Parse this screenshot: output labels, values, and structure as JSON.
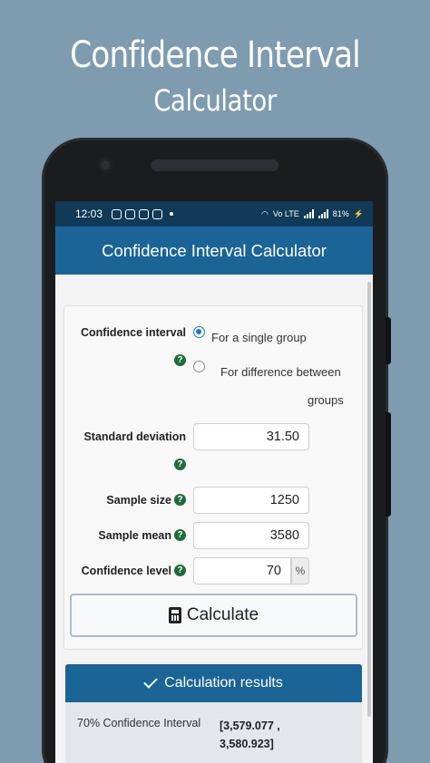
{
  "promo": {
    "title_line1": "Confidence Interval",
    "title_line2": "Calculator"
  },
  "status_bar": {
    "time": "12:03",
    "battery": "81%",
    "network": "Vo LTE"
  },
  "app_bar": {
    "title": "Confidence Interval Calculator"
  },
  "form": {
    "confidence_interval_label": "Confidence interval",
    "options": [
      {
        "label": "For a single group",
        "selected": true
      },
      {
        "label_line1": "For difference between",
        "label_line2": "groups",
        "selected": false
      }
    ],
    "standard_deviation": {
      "label": "Standard deviation",
      "value": "31.50"
    },
    "sample_size": {
      "label": "Sample size",
      "value": "1250"
    },
    "sample_mean": {
      "label": "Sample mean",
      "value": "3580"
    },
    "confidence_level": {
      "label": "Confidence level",
      "value": "70",
      "unit": "%"
    },
    "help_symbol": "?",
    "calculate_label": "Calculate"
  },
  "results": {
    "header": "Calculation results",
    "row_label": "70% Confidence Interval",
    "value_line1": "[3,579.077 ,",
    "value_line2": "3,580.923]"
  },
  "colors": {
    "app_bar": "#1b6496",
    "status_bar": "#103a57",
    "help_badge": "#1e6b3a",
    "radio_accent": "#1a73d9",
    "background": "#7f9bb0"
  }
}
